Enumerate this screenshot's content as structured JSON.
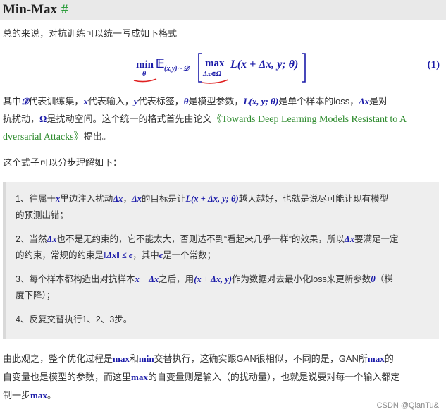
{
  "header": {
    "title": "Min-Max",
    "anchor": "#"
  },
  "intro": "总的来说，对抗训练可以统一写成如下格式",
  "formula": {
    "min": "min",
    "min_sub": "θ",
    "expect": "𝔼",
    "expect_sub": "(x,y)∼𝒟",
    "max": "max",
    "max_sub": "Δx∈Ω",
    "loss": "L(x + Δx, y; θ)",
    "eq_number": "(1)"
  },
  "para1": {
    "l1": [
      "其中",
      "𝒟",
      "代表训练集，",
      "x",
      "代表输入，",
      "y",
      "代表标签，",
      "θ",
      "是模型参数，",
      "L(x, y; θ)",
      "是单个样本的loss，",
      "Δx",
      "是对"
    ],
    "l2": [
      "抗扰动，",
      "Ω",
      "是扰动空间。这个统一的格式首先由论文",
      "《Towards Deep Learning Models Resistant to A"
    ],
    "l3": [
      "dversarial Attacks》",
      "提出。"
    ]
  },
  "para2": "这个式子可以分步理解如下：",
  "steps": {
    "s1a": [
      "1、往属于",
      "x",
      "里边注入扰动",
      "Δx",
      "，",
      "Δx",
      "的目标是让",
      "L(x + Δx, y; θ)",
      "越大越好，也就是说尽可能让现有模型"
    ],
    "s1b": "的预测出错；",
    "s2a": [
      "2、当然",
      "Δx",
      "也不是无约束的，它不能太大，否则达不到“看起来几乎一样”的效果，所以",
      "Δx",
      "要满足一定"
    ],
    "s2b": [
      "的约束，常规的约束是",
      "‖Δx‖ ≤ ϵ",
      "，其中",
      "ϵ",
      "是一个常数；"
    ],
    "s3a": [
      "3、每个样本都构造出对抗样本",
      "x + Δx",
      "之后，用",
      "(x + Δx, y)",
      "作为数据对去最小化loss来更新参数",
      "θ",
      "（梯"
    ],
    "s3b": "度下降）；",
    "s4": "4、反复交替执行1、2、3步。"
  },
  "para3": {
    "l1": [
      "由此观之，整个优化过程是",
      "max",
      "和",
      "min",
      "交替执行，这确实跟GAN很相似，不同的是，GAN所",
      "max",
      "的"
    ],
    "l2": [
      "自变量也是模型的参数，而这里",
      "max",
      "的自变量则是输入（的扰动量），也就是说要对每一个输入都定"
    ],
    "l3": [
      "制一步",
      "max",
      "。"
    ]
  },
  "watermark": "CSDN @QianTu&",
  "colors": {
    "math": "#1a1aa8",
    "link": "#2e8b2e",
    "underline": "#e02020",
    "quote_bg": "#eeeeee"
  }
}
